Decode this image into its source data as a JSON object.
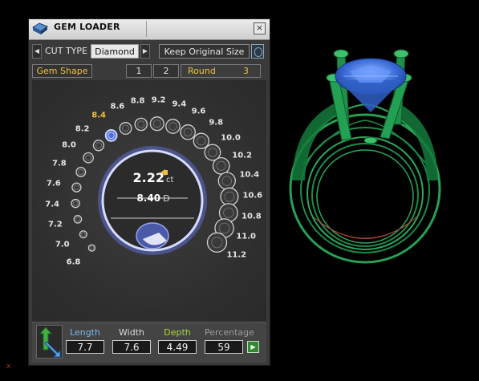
{
  "window": {
    "title": "GEM LOADER",
    "close_label": "×"
  },
  "cut_type": {
    "label": "CUT TYPE",
    "value": "Diamond",
    "prev": "◀",
    "next": "▶"
  },
  "keep_size": {
    "label": "Keep Original Size"
  },
  "tabs": {
    "gem_shape": "Gem Shape",
    "t1": "1",
    "t2": "2",
    "round": "Round",
    "count": "3"
  },
  "dial": {
    "sizes": [
      "6.8",
      "7.0",
      "7.2",
      "7.4",
      "7.6",
      "7.8",
      "8.0",
      "8.2",
      "8.4",
      "8.6",
      "8.8",
      "9.2",
      "9.4",
      "9.6",
      "9.8",
      "10.0",
      "10.2",
      "10.4",
      "10.6",
      "10.8",
      "11.0",
      "11.2"
    ],
    "selected": "8.4",
    "carat_value": "2.22",
    "carat_unit": "ct",
    "diameter_value": "8.40",
    "diameter_unit": "D"
  },
  "measurements": {
    "length_label": "Length",
    "length": "7.7",
    "width_label": "Width",
    "width": "7.6",
    "depth_label": "Depth",
    "depth": "4.49",
    "percentage_label": "Percentage",
    "percentage": "59",
    "apply": "▶"
  },
  "colors": {
    "accent": "#f0c040",
    "depth_label": "#a9d83a",
    "length_label": "#7ab6e8",
    "ring_green": "#1f8a47",
    "gem_blue": "#3a6cd8"
  },
  "corner_mark": "x"
}
